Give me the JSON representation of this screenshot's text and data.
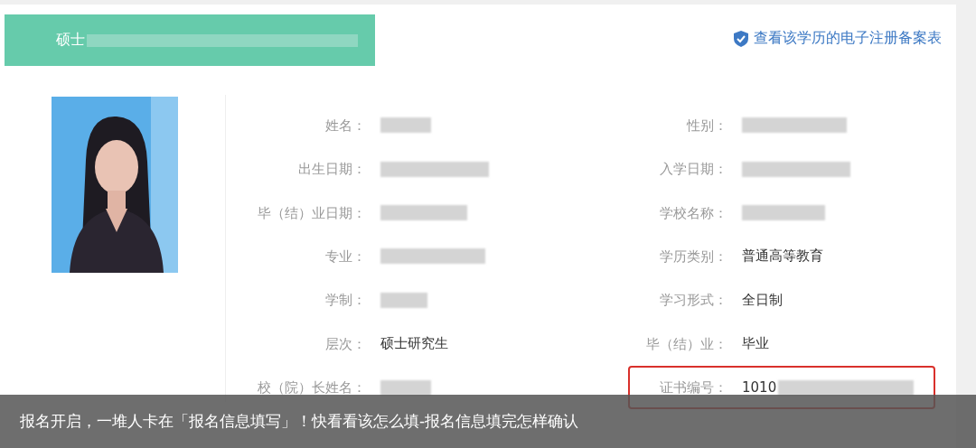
{
  "header": {
    "degree": "硕士",
    "redacted": true
  },
  "registration_link": {
    "label": "查看该学历的电子注册备案表"
  },
  "fields": [
    {
      "label": "姓名：",
      "redacted": true
    },
    {
      "label": "性别：",
      "redacted": true
    },
    {
      "label": "出生日期：",
      "redacted": true
    },
    {
      "label": "入学日期：",
      "redacted": true
    },
    {
      "label": "毕（结）业日期：",
      "redacted": true
    },
    {
      "label": "学校名称：",
      "redacted": true
    },
    {
      "label": "专业：",
      "redacted": true
    },
    {
      "label": "学历类别：",
      "value": "普通高等教育",
      "redacted": false
    },
    {
      "label": "学制：",
      "redacted": true
    },
    {
      "label": "学习形式：",
      "value": "全日制",
      "redacted": false
    },
    {
      "label": "层次：",
      "value": "硕士研究生",
      "redacted": false
    },
    {
      "label": "毕（结）业：",
      "value": "毕业",
      "redacted": false
    },
    {
      "label": "校（院）长姓名：",
      "redacted": true
    },
    {
      "label": "证书编号：",
      "value": "1010",
      "redacted": true,
      "highlighted": true
    }
  ],
  "caption": "报名开启，一堆人卡在「报名信息填写」！快看看该怎么填-报名信息填完怎样确认"
}
